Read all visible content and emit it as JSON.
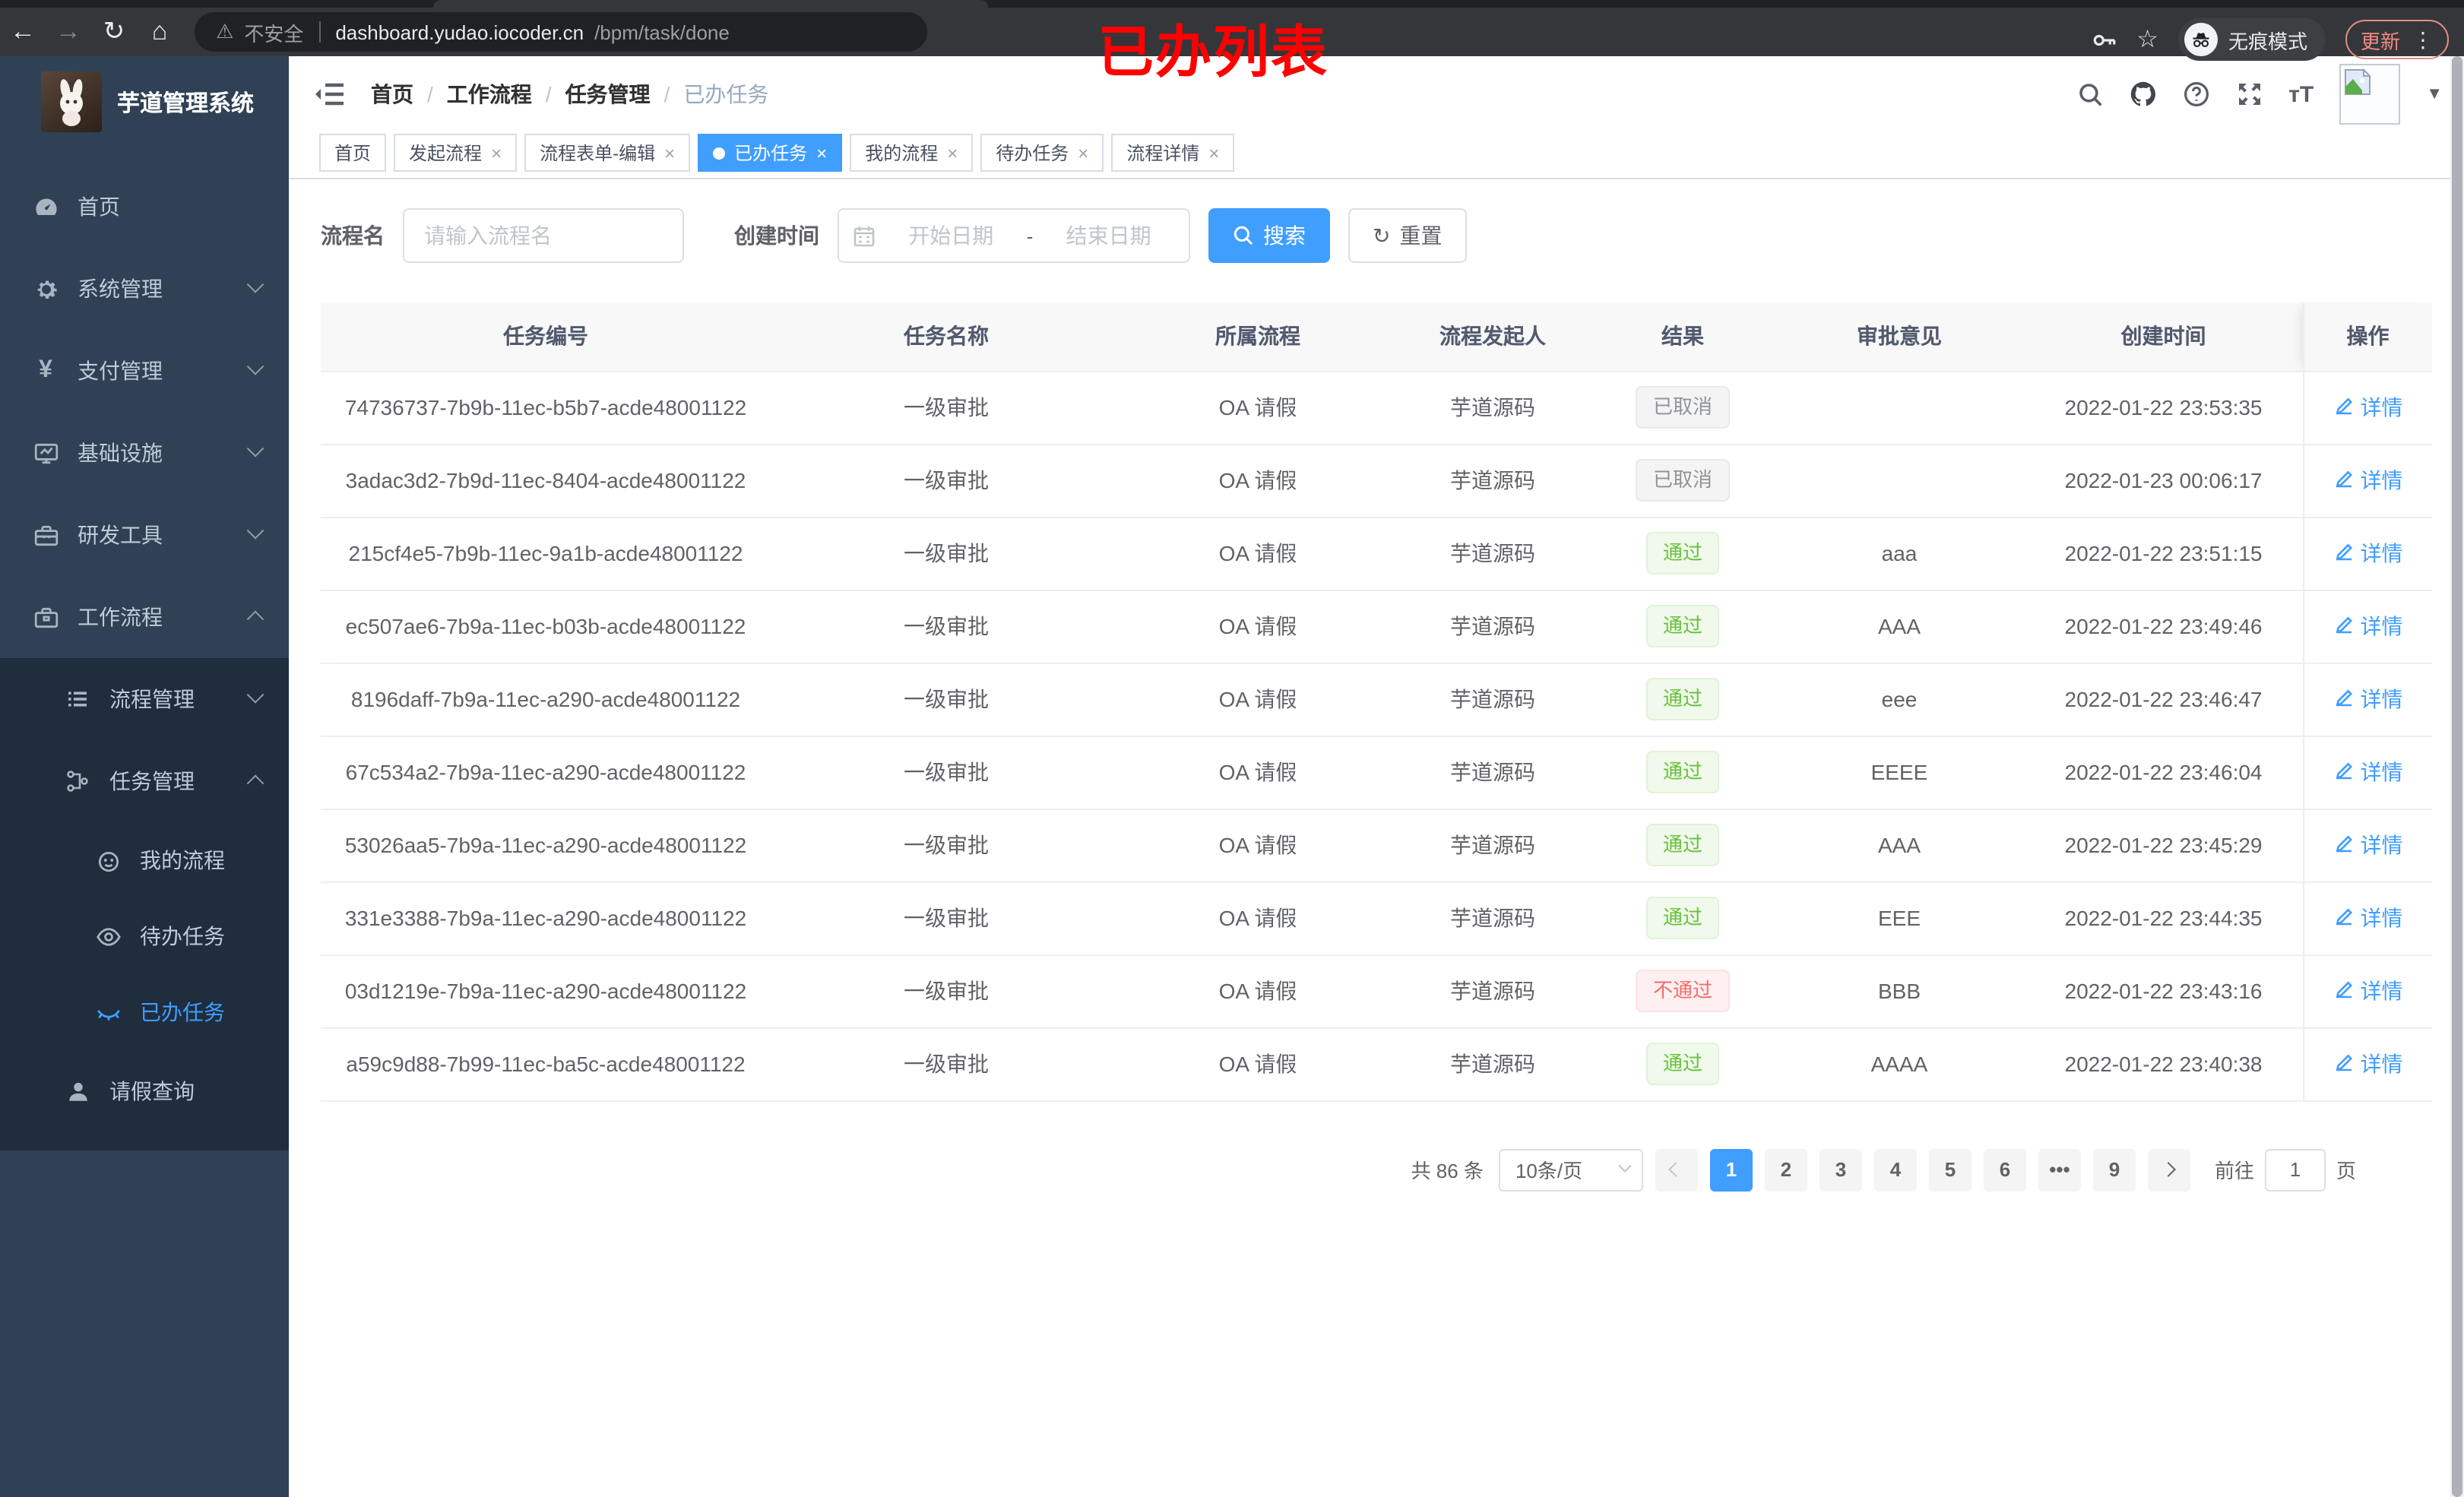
{
  "browser": {
    "security_label": "不安全",
    "url_host": "dashboard.yudao.iocoder.cn",
    "url_path": "/bpm/task/done",
    "incognito_label": "无痕模式",
    "update_label": "更新"
  },
  "annotation": "已办列表",
  "sidebar": {
    "title": "芋道管理系统",
    "items": [
      {
        "label": "首页",
        "icon": "gauge-icon",
        "chevron": ""
      },
      {
        "label": "系统管理",
        "icon": "gear-icon",
        "chevron": "down"
      },
      {
        "label": "支付管理",
        "icon": "yen-icon",
        "chevron": "down"
      },
      {
        "label": "基础设施",
        "icon": "monitor-icon",
        "chevron": "down"
      },
      {
        "label": "研发工具",
        "icon": "toolbox-icon",
        "chevron": "down"
      },
      {
        "label": "工作流程",
        "icon": "briefcase-icon",
        "chevron": "up"
      }
    ],
    "submenu": [
      {
        "label": "流程管理",
        "icon": "list-icon",
        "chevron": "down",
        "level": 1,
        "active": false
      },
      {
        "label": "任务管理",
        "icon": "tree-icon",
        "chevron": "up",
        "level": 1,
        "active": false
      },
      {
        "label": "我的流程",
        "icon": "face-icon",
        "chevron": "",
        "level": 2,
        "active": false
      },
      {
        "label": "待办任务",
        "icon": "eye-icon",
        "chevron": "",
        "level": 2,
        "active": false
      },
      {
        "label": "已办任务",
        "icon": "eye-closed-icon",
        "chevron": "",
        "level": 2,
        "active": true
      },
      {
        "label": "请假查询",
        "icon": "person-icon",
        "chevron": "",
        "level": 1,
        "active": false
      }
    ]
  },
  "breadcrumb": [
    "首页",
    "工作流程",
    "任务管理",
    "已办任务"
  ],
  "tabs": [
    {
      "label": "首页",
      "closable": false,
      "active": false
    },
    {
      "label": "发起流程",
      "closable": true,
      "active": false
    },
    {
      "label": "流程表单-编辑",
      "closable": true,
      "active": false
    },
    {
      "label": "已办任务",
      "closable": true,
      "active": true
    },
    {
      "label": "我的流程",
      "closable": true,
      "active": false
    },
    {
      "label": "待办任务",
      "closable": true,
      "active": false
    },
    {
      "label": "流程详情",
      "closable": true,
      "active": false
    }
  ],
  "filters": {
    "name_label": "流程名",
    "name_placeholder": "请输入流程名",
    "time_label": "创建时间",
    "start_placeholder": "开始日期",
    "range_separator": "-",
    "end_placeholder": "结束日期",
    "search_label": "搜索",
    "reset_label": "重置"
  },
  "table": {
    "headers": [
      "任务编号",
      "任务名称",
      "所属流程",
      "流程发起人",
      "结果",
      "审批意见",
      "创建时间",
      "操作"
    ],
    "detail_label": "详情",
    "rows": [
      {
        "id": "74736737-7b9b-11ec-b5b7-acde48001122",
        "name": "一级审批",
        "process": "OA 请假",
        "initiator": "芋道源码",
        "result": "已取消",
        "result_type": "info",
        "comment": "",
        "time": "2022-01-22 23:53:35"
      },
      {
        "id": "3adac3d2-7b9d-11ec-8404-acde48001122",
        "name": "一级审批",
        "process": "OA 请假",
        "initiator": "芋道源码",
        "result": "已取消",
        "result_type": "info",
        "comment": "",
        "time": "2022-01-23 00:06:17"
      },
      {
        "id": "215cf4e5-7b9b-11ec-9a1b-acde48001122",
        "name": "一级审批",
        "process": "OA 请假",
        "initiator": "芋道源码",
        "result": "通过",
        "result_type": "success",
        "comment": "aaa",
        "time": "2022-01-22 23:51:15"
      },
      {
        "id": "ec507ae6-7b9a-11ec-b03b-acde48001122",
        "name": "一级审批",
        "process": "OA 请假",
        "initiator": "芋道源码",
        "result": "通过",
        "result_type": "success",
        "comment": "AAA",
        "time": "2022-01-22 23:49:46"
      },
      {
        "id": "8196daff-7b9a-11ec-a290-acde48001122",
        "name": "一级审批",
        "process": "OA 请假",
        "initiator": "芋道源码",
        "result": "通过",
        "result_type": "success",
        "comment": "eee",
        "time": "2022-01-22 23:46:47"
      },
      {
        "id": "67c534a2-7b9a-11ec-a290-acde48001122",
        "name": "一级审批",
        "process": "OA 请假",
        "initiator": "芋道源码",
        "result": "通过",
        "result_type": "success",
        "comment": "EEEE",
        "time": "2022-01-22 23:46:04"
      },
      {
        "id": "53026aa5-7b9a-11ec-a290-acde48001122",
        "name": "一级审批",
        "process": "OA 请假",
        "initiator": "芋道源码",
        "result": "通过",
        "result_type": "success",
        "comment": "AAA",
        "time": "2022-01-22 23:45:29"
      },
      {
        "id": "331e3388-7b9a-11ec-a290-acde48001122",
        "name": "一级审批",
        "process": "OA 请假",
        "initiator": "芋道源码",
        "result": "通过",
        "result_type": "success",
        "comment": "EEE",
        "time": "2022-01-22 23:44:35"
      },
      {
        "id": "03d1219e-7b9a-11ec-a290-acde48001122",
        "name": "一级审批",
        "process": "OA 请假",
        "initiator": "芋道源码",
        "result": "不通过",
        "result_type": "danger",
        "comment": "BBB",
        "time": "2022-01-22 23:43:16"
      },
      {
        "id": "a59c9d88-7b99-11ec-ba5c-acde48001122",
        "name": "一级审批",
        "process": "OA 请假",
        "initiator": "芋道源码",
        "result": "通过",
        "result_type": "success",
        "comment": "AAAA",
        "time": "2022-01-22 23:40:38"
      }
    ]
  },
  "pagination": {
    "total": "共 86 条",
    "page_size": "10条/页",
    "pages": [
      "1",
      "2",
      "3",
      "4",
      "5",
      "6",
      "•••",
      "9"
    ],
    "active_page": "1",
    "goto_label": "前往",
    "goto_value": "1",
    "page_label": "页"
  },
  "colors": {
    "accent": "#409eff",
    "success": "#67c23a",
    "danger": "#f56c6c",
    "info": "#909399",
    "sidebar": "#304156",
    "submenu": "#1f2d3d"
  }
}
